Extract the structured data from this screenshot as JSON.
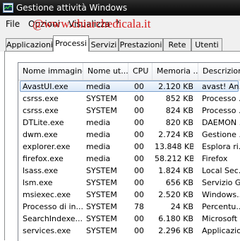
{
  "window": {
    "title": "Gestione attività Windows"
  },
  "menu": [
    "File",
    "Opzioni",
    "Visualizza",
    "?"
  ],
  "watermark": "@www.chiarchedicala.it",
  "tabs": [
    "Applicazioni",
    "Processi",
    "Servizi",
    "Prestazioni",
    "Rete",
    "Utenti"
  ],
  "active_tab": "Processi",
  "columns": [
    "Nome immagine",
    "Nome ut...",
    "CPU",
    "Memoria ...",
    "Descrizione"
  ],
  "sorted_column": "Nome immagine",
  "rows": [
    {
      "name": "AvastUI.exe",
      "user": "media",
      "cpu": "00",
      "mem": "2.120 KB",
      "desc": "avast! An..."
    },
    {
      "name": "csrss.exe",
      "user": "SYSTEM",
      "cpu": "00",
      "mem": "852 KB",
      "desc": "Processo ..."
    },
    {
      "name": "csrss.exe",
      "user": "SYSTEM",
      "cpu": "00",
      "mem": "824 KB",
      "desc": "Processo ..."
    },
    {
      "name": "DTLite.exe",
      "user": "media",
      "cpu": "00",
      "mem": "820 KB",
      "desc": "DAEMON ..."
    },
    {
      "name": "dwm.exe",
      "user": "media",
      "cpu": "00",
      "mem": "2.724 KB",
      "desc": "Gestione ..."
    },
    {
      "name": "explorer.exe",
      "user": "media",
      "cpu": "00",
      "mem": "13.848 KB",
      "desc": "Esplora ri..."
    },
    {
      "name": "firefox.exe",
      "user": "media",
      "cpu": "00",
      "mem": "58.212 KB",
      "desc": "Firefox"
    },
    {
      "name": "lsass.exe",
      "user": "SYSTEM",
      "cpu": "00",
      "mem": "1.824 KB",
      "desc": "Local Sec..."
    },
    {
      "name": "lsm.exe",
      "user": "SYSTEM",
      "cpu": "00",
      "mem": "656 KB",
      "desc": "Servizio G..."
    },
    {
      "name": "msiexec.exe",
      "user": "SYSTEM",
      "cpu": "00",
      "mem": "2.520 KB",
      "desc": "Windows..."
    },
    {
      "name": "Processo di in...",
      "user": "SYSTEM",
      "cpu": "78",
      "mem": "24 KB",
      "desc": "Percentu..."
    },
    {
      "name": "SearchIndexe...",
      "user": "SYSTEM",
      "cpu": "00",
      "mem": "6.180 KB",
      "desc": "Microsoft ..."
    },
    {
      "name": "services.exe",
      "user": "SYSTEM",
      "cpu": "00",
      "mem": "2.296 KB",
      "desc": "Applicazio..."
    }
  ],
  "selected_row": 0,
  "colors": {
    "titlebar": "#1a1a1a",
    "watermark": "#d61d1d",
    "selection": "#dbe8f8"
  }
}
